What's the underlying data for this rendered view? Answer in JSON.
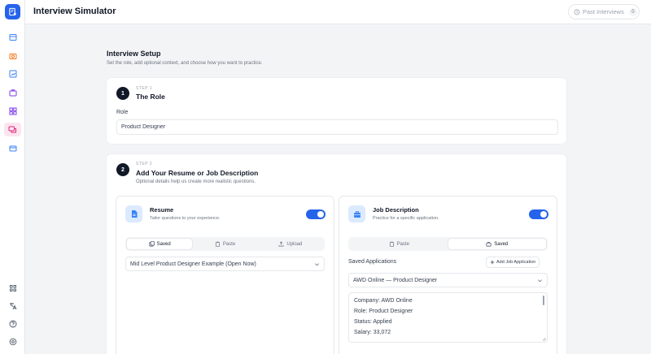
{
  "app": {
    "title": "Interview Simulator"
  },
  "header": {
    "past_interviews_label": "Past Interviews",
    "past_interviews_count": "0"
  },
  "setup": {
    "title": "Interview Setup",
    "subtitle": "Set the role, add optional context, and choose how you want to practice."
  },
  "step1": {
    "number": "1",
    "kicker": "STEP 1",
    "title": "The Role",
    "field_label": "Role",
    "role_value": "Product Designer"
  },
  "step2": {
    "number": "2",
    "kicker": "STEP 2",
    "title": "Add Your Resume or Job Description",
    "subtitle": "Optional details help us create more realistic questions.",
    "resume": {
      "title": "Resume",
      "subtitle": "Tailor questions to your experience.",
      "enabled": true,
      "tabs": [
        "Saved",
        "Paste",
        "Upload"
      ],
      "active_tab": "Saved",
      "selected": "Mid Level Product Designer Example (Open Now)"
    },
    "job": {
      "title": "Job Description",
      "subtitle": "Practice for a specific application.",
      "enabled": true,
      "tabs": [
        "Paste",
        "Saved"
      ],
      "active_tab": "Saved",
      "saved_label": "Saved Applications",
      "add_label": "Add Job Application",
      "selected": "AWD Online — Product Designer",
      "details": [
        "Company: AWD Online",
        "Role: Product Designer",
        "Status: Applied",
        "Salary: 33,072"
      ]
    }
  },
  "colors": {
    "accent": "#2563eb",
    "active_nav_bg": "#fde4ef",
    "badge_bg": "#111827"
  },
  "sidebar": {
    "icons": [
      "logo-icon",
      "dashboard-icon",
      "camera-icon",
      "chart-icon",
      "briefcase-icon",
      "grid-icon",
      "chat-icon",
      "card-icon",
      "apps-icon",
      "translate-icon",
      "help-icon",
      "settings-icon"
    ],
    "active": "chat-icon"
  }
}
